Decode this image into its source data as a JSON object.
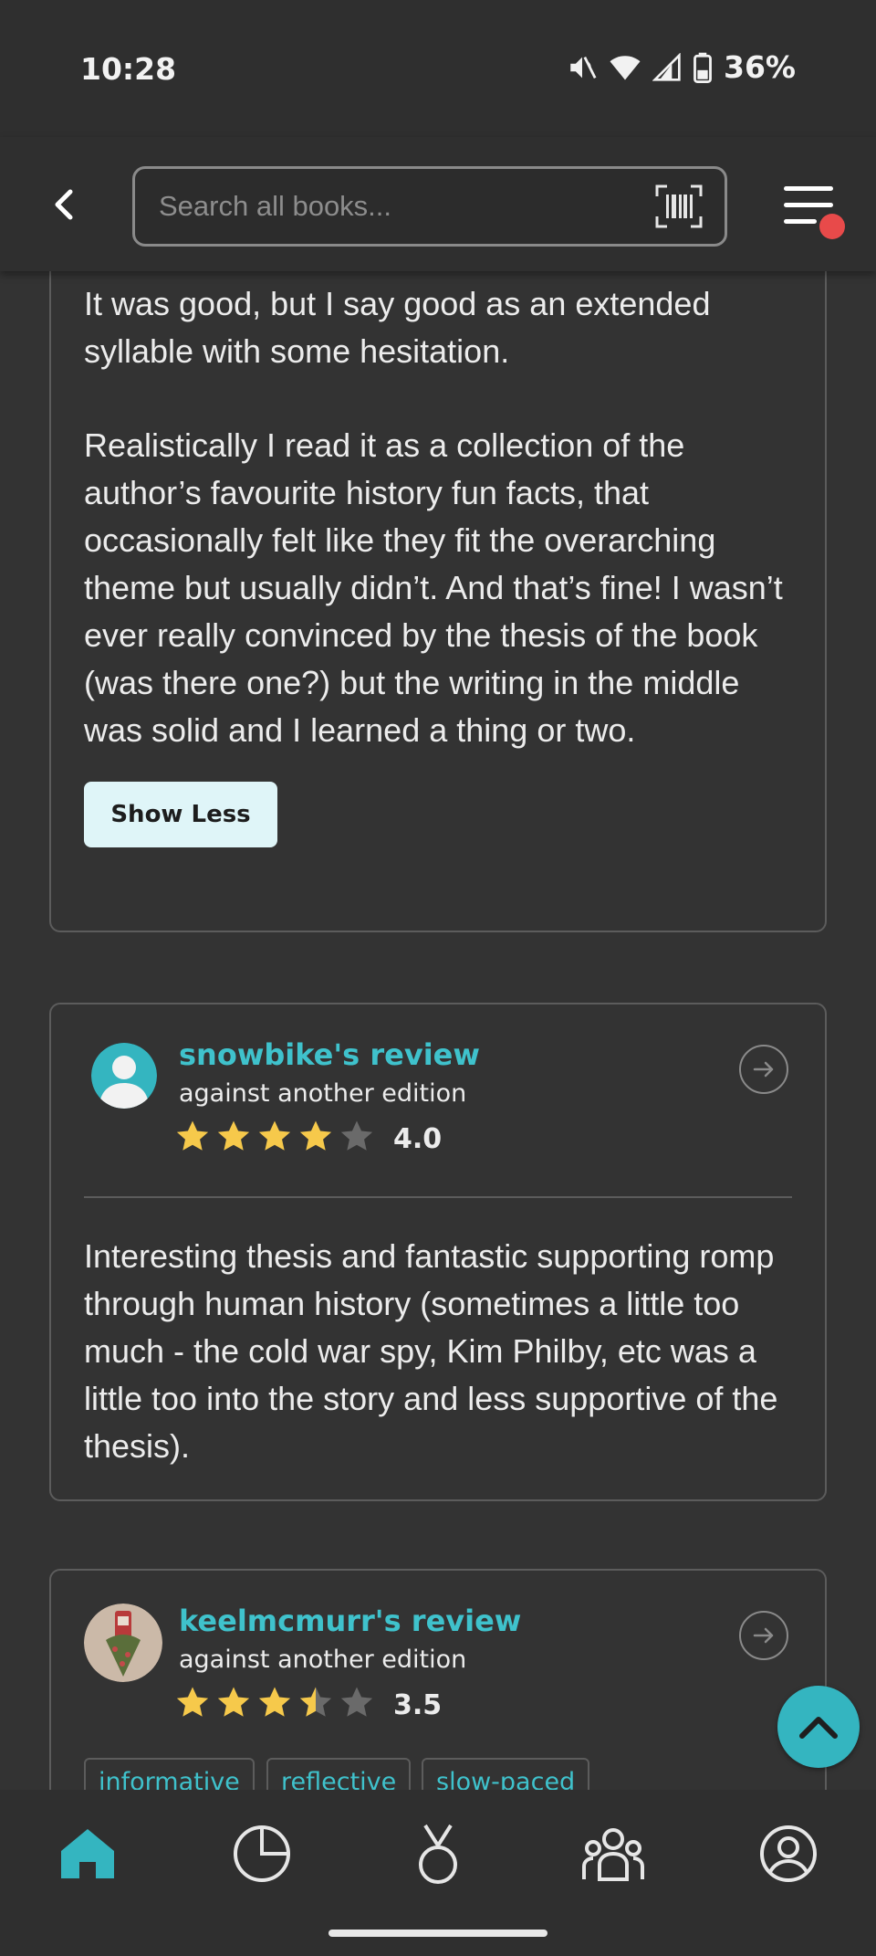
{
  "status_bar": {
    "time": "10:28",
    "battery": "36%",
    "icons": [
      "mute-icon",
      "wifi-icon",
      "signal-icon",
      "battery-icon"
    ]
  },
  "header": {
    "back_icon": "chevron-left-icon",
    "search_placeholder": "Search all books...",
    "barcode_icon": "barcode-scan-icon",
    "menu_icon": "hamburger-menu-icon",
    "notification_dot_color": "#e84a4a"
  },
  "colors": {
    "accent": "#3fc2cc",
    "background": "#333333",
    "star_filled": "#f6c94b",
    "star_empty": "#6a6a6a"
  },
  "review_1": {
    "paragraph_1": "It was good, but I say good as an extended syllable with some hesitation.",
    "paragraph_2": "Realistically I read it as a collection of the author’s favourite history fun facts, that occasionally felt like they fit the overarching theme but usually didn’t. And that’s fine! I wasn’t ever really convinced by the thesis of the book (was there one?) but the writing in the middle was solid and I learned a thing or two.",
    "toggle_label": "Show Less"
  },
  "review_2": {
    "reviewer": "snowbike's review",
    "edition_note": "against another edition",
    "rating": 4.0,
    "rating_text": "4.0",
    "body": "Interesting thesis and fantastic supporting romp through human history (sometimes a little too much - the cold war spy, Kim Philby, etc was a little too into the story and less supportive of the thesis)."
  },
  "review_3": {
    "reviewer": "keelmcmurr's review",
    "edition_note": "against another edition",
    "rating": 3.5,
    "rating_text": "3.5",
    "tags": [
      "informative",
      "reflective",
      "slow-paced"
    ]
  },
  "bottom_nav": {
    "items": [
      "home-icon",
      "stats-icon",
      "challenges-icon",
      "community-icon",
      "profile-icon"
    ],
    "active": "home-icon"
  }
}
